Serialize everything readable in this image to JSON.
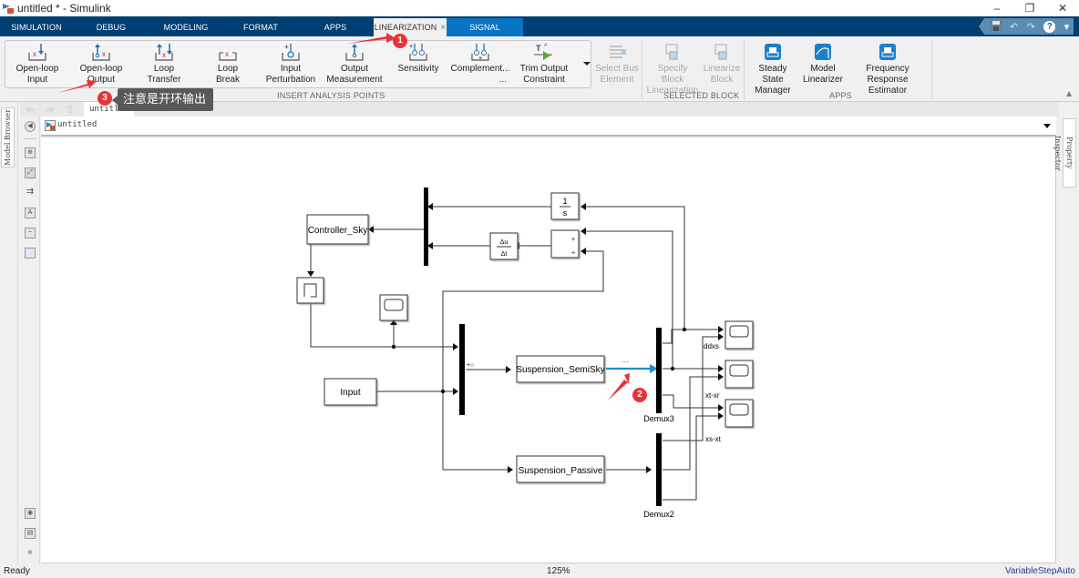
{
  "window": {
    "title": "untitled * - Simulink",
    "minimize": "–",
    "maximize": "❐",
    "close": "✕"
  },
  "tabs": [
    {
      "label": "SIMULATION"
    },
    {
      "label": "DEBUG"
    },
    {
      "label": "MODELING"
    },
    {
      "label": "FORMAT"
    },
    {
      "label": "APPS"
    },
    {
      "label": "LINEARIZATION",
      "active": true,
      "close": "×"
    },
    {
      "label": "SIGNAL"
    }
  ],
  "quick_access": {
    "save": "save-icon",
    "undo": "↶",
    "redo": "↷",
    "help": "?",
    "more": "▾"
  },
  "ribbon": {
    "insert_analysis_points": {
      "label": "INSERT ANALYSIS POINTS",
      "buttons": [
        {
          "line1": "Open-loop",
          "line2": "Input"
        },
        {
          "line1": "Open-loop",
          "line2": "Output"
        },
        {
          "line1": "Loop",
          "line2": "Transfer"
        },
        {
          "line1": "Loop",
          "line2": "Break"
        },
        {
          "line1": "Input",
          "line2": "Perturbation"
        },
        {
          "line1": "Output",
          "line2": "Measurement"
        },
        {
          "line1": "Sensitivity",
          "line2": ""
        },
        {
          "line1": "Complement...",
          "line2": "..."
        },
        {
          "line1": "Trim Output",
          "line2": "Constraint"
        }
      ]
    },
    "select_bus": {
      "line1": "Select Bus",
      "line2": "Element"
    },
    "selected_block": {
      "label": "SELECTED BLOCK",
      "buttons": [
        {
          "line1": "Specify Block",
          "line2": "Linearization"
        },
        {
          "line1": "Linearize",
          "line2": "Block"
        }
      ]
    },
    "apps": {
      "label": "APPS",
      "buttons": [
        {
          "line1": "Steady State",
          "line2": "Manager"
        },
        {
          "line1": "Model",
          "line2": "Linearizer"
        },
        {
          "line1": "Frequency Response",
          "line2": "Estimator"
        }
      ]
    }
  },
  "annotations": {
    "badge1": "1",
    "badge2": "2",
    "badge3": "3",
    "tooltip": "注意是开环输出",
    "accent_color": "#e8333a"
  },
  "navigation": {
    "tab": "untitled",
    "address": "untitled"
  },
  "side_panels": {
    "left": "Model Browser",
    "right": "Property Inspector"
  },
  "diagram": {
    "blocks": {
      "controller": "Controller_Sky",
      "integrator_num": "1",
      "integrator_den": "s",
      "derivative_num": "Δu",
      "derivative_den": "Δt",
      "sum_plus1": "+",
      "sum_plus2": "+",
      "input": "Input",
      "semisky": "Suspension_SemiSky",
      "passive": "Suspension_Passive",
      "demux3": "Demux3",
      "demux2": "Demux2",
      "signal_dots": "...",
      "lin_marker": "+○"
    },
    "signal_labels": [
      "ddxs",
      "xt-xr",
      "xs-xt"
    ]
  },
  "status": {
    "ready": "Ready",
    "zoom": "125%",
    "solver": "VariableStepAuto"
  }
}
